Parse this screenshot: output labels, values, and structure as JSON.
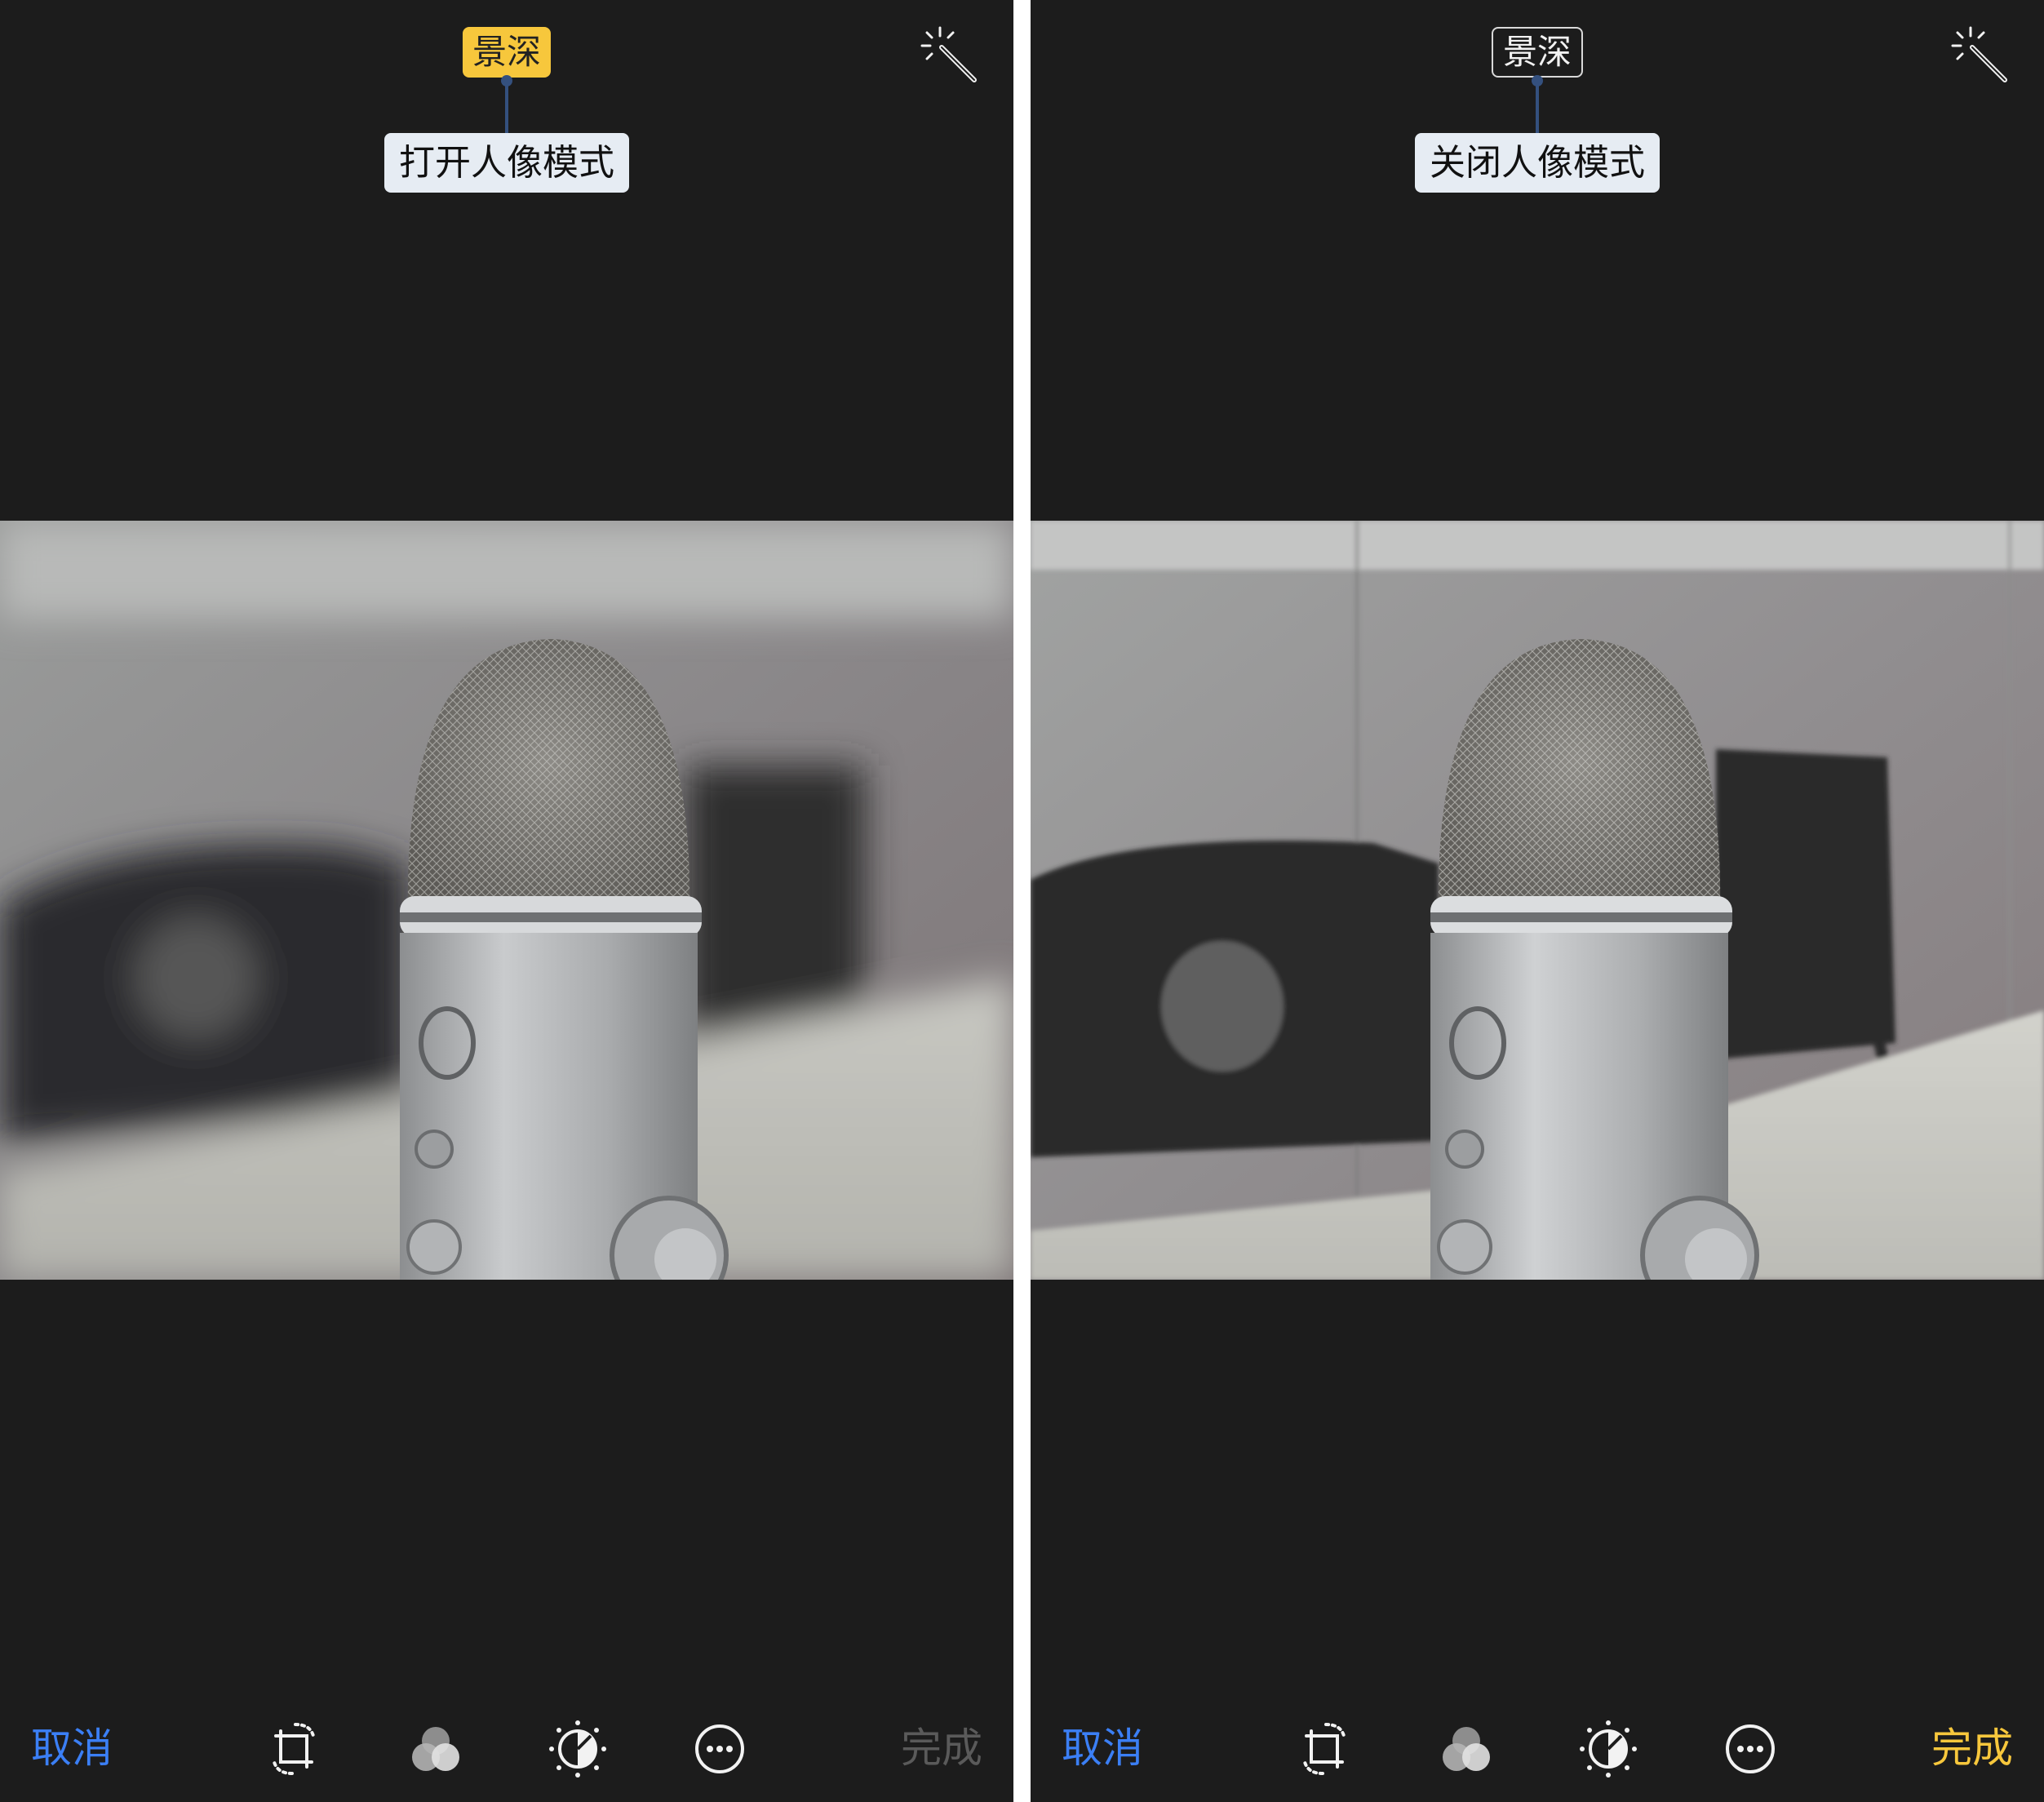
{
  "panels": [
    {
      "depth_label": "景深",
      "depth_state": "active",
      "tooltip": "打开人像模式",
      "cancel_label": "取消",
      "done_label": "完成",
      "done_state": "disabled",
      "icons": [
        "magic-wand-icon",
        "crop-rotate-icon",
        "filters-icon",
        "adjust-dial-icon",
        "more-icon"
      ]
    },
    {
      "depth_label": "景深",
      "depth_state": "inactive",
      "tooltip": "关闭人像模式",
      "cancel_label": "取消",
      "done_label": "完成",
      "done_state": "enabled",
      "icons": [
        "magic-wand-icon",
        "crop-rotate-icon",
        "filters-icon",
        "adjust-dial-icon",
        "more-icon"
      ]
    }
  ],
  "colors": {
    "background": "#1c1c1c",
    "accent_yellow": "#f7c73c",
    "link_blue": "#3b7ff5",
    "tooltip_bg": "#e6ecf3",
    "connector": "#34507e",
    "done_disabled": "#5a5a5a"
  }
}
